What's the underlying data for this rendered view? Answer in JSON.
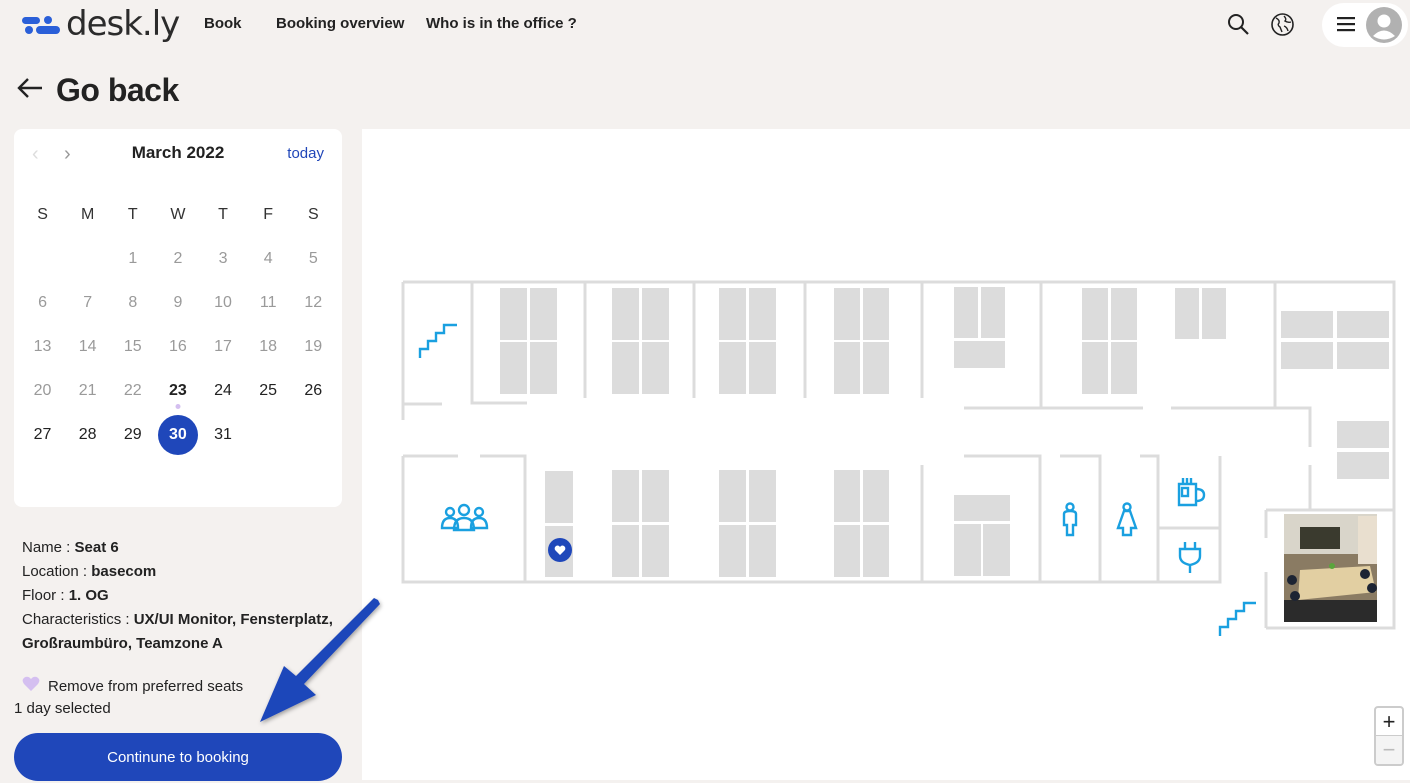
{
  "app": {
    "logo_text": "desk.ly",
    "brand_color": "#1f47ba"
  },
  "nav": {
    "items": [
      {
        "label": "Book"
      },
      {
        "label": "Booking overview"
      },
      {
        "label": "Who is in the office ?"
      }
    ]
  },
  "header_icons": [
    "search-icon",
    "globe-icon",
    "menu-icon",
    "user-avatar-icon"
  ],
  "page": {
    "back_label": "Go back"
  },
  "calendar": {
    "month_label": "March 2022",
    "today_label": "today",
    "weekdays": [
      "S",
      "M",
      "T",
      "W",
      "T",
      "F",
      "S"
    ],
    "weeks": [
      [
        "",
        "",
        "1",
        "2",
        "3",
        "4",
        "5"
      ],
      [
        "6",
        "7",
        "8",
        "9",
        "10",
        "11",
        "12"
      ],
      [
        "13",
        "14",
        "15",
        "16",
        "17",
        "18",
        "19"
      ],
      [
        "20",
        "21",
        "22",
        "23",
        "24",
        "25",
        "26"
      ],
      [
        "27",
        "28",
        "29",
        "30",
        "31",
        "",
        ""
      ]
    ],
    "today": "23",
    "selected": "30",
    "selected_color": "#1f47ba",
    "today_dot_color": "#d4bff0"
  },
  "seat": {
    "name_label": "Name : ",
    "name": "Seat 6",
    "location_label": "Location : ",
    "location": "basecom",
    "floor_label": "Floor : ",
    "floor": "1. OG",
    "characteristics_label": "Characteristics : ",
    "characteristics_line1": "UX/UI Monitor, Fensterplatz,",
    "characteristics_line2": "Großraumbüro, Teamzone A"
  },
  "preferred": {
    "label": "Remove from preferred seats",
    "heart_color": "#d4bff0"
  },
  "selection": {
    "summary": "1 day selected"
  },
  "actions": {
    "continue_label": "Continune to booking"
  },
  "map": {
    "amenity_color": "#1aa0e0",
    "amenities": [
      "stairs-icon",
      "meeting-room-icon",
      "male-restroom-icon",
      "female-restroom-icon",
      "coffee-icon",
      "power-plug-icon",
      "stairs-icon",
      "meeting-room-photo"
    ],
    "zoom_in_label": "+",
    "zoom_out_label": "−"
  }
}
